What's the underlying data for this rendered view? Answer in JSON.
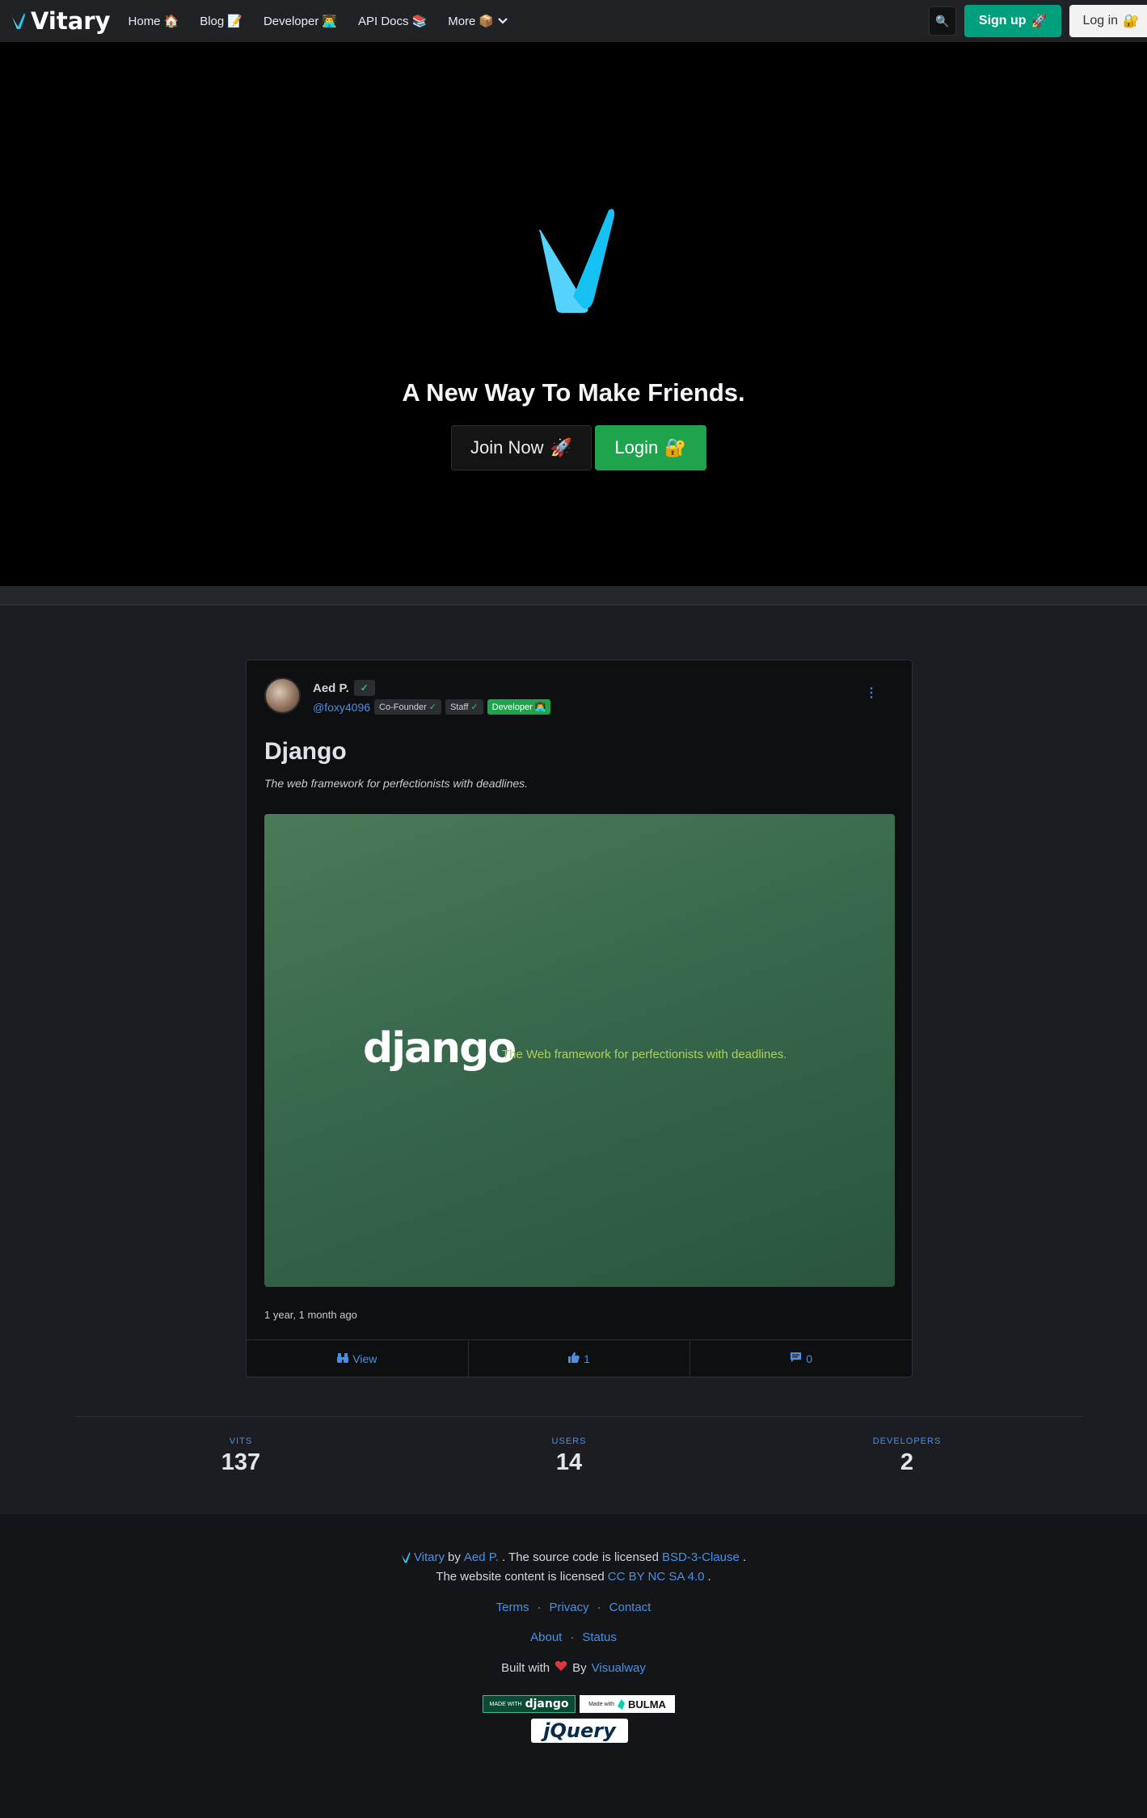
{
  "navbar": {
    "brand": "Vitary",
    "items": [
      {
        "label": "Home",
        "emoji": "🏠"
      },
      {
        "label": "Blog",
        "emoji": "📝"
      },
      {
        "label": "Developer",
        "emoji": "👨‍💻"
      },
      {
        "label": "API Docs",
        "emoji": "📚"
      },
      {
        "label": "More",
        "emoji": "📦"
      }
    ],
    "search_emoji": "🔍",
    "signup_label": "Sign up",
    "signup_emoji": "🚀",
    "login_label": "Log in",
    "login_emoji": "🔐"
  },
  "hero": {
    "title": "A New Way To Make Friends.",
    "join_label": "Join Now",
    "join_emoji": "🚀",
    "login_label": "Login",
    "login_emoji": "🔐"
  },
  "post": {
    "author_name": "Aed P.",
    "handle": "@foxy4096",
    "tags": [
      {
        "label": "Co-Founder"
      },
      {
        "label": "Staff"
      },
      {
        "label": "Developer",
        "emoji": "👨‍💻"
      }
    ],
    "title": "Django",
    "subtitle": "The web framework for perfectionists with deadlines.",
    "image_word": "django",
    "image_tagline": "The Web framework for perfectionists with deadlines.",
    "time": "1 year, 1 month ago",
    "actions": {
      "view_label": "View",
      "likes": "1",
      "comments": "0"
    }
  },
  "stats": [
    {
      "label": "VITS",
      "value": "137"
    },
    {
      "label": "USERS",
      "value": "14"
    },
    {
      "label": "DEVELOPERS",
      "value": "2"
    }
  ],
  "footer": {
    "brand": "Vitary",
    "by": "by",
    "author": "Aed P.",
    "license_text": ". The source code is licensed",
    "license_link": "BSD-3-Clause",
    "content_text": "The website content is licensed",
    "content_link": "CC BY NC SA 4.0",
    "links1": [
      "Terms",
      "Privacy",
      "Contact"
    ],
    "links2": [
      "About",
      "Status"
    ],
    "built_text": "Built with",
    "built_by": "By",
    "built_by_link": "Visualway",
    "badge_django_small": "MADE WITH",
    "badge_django_big": "django",
    "badge_bulma_small": "Made with",
    "badge_bulma_big": "BULMA",
    "badge_jquery": "jQuery"
  },
  "colors": {
    "accent_blue": "#4a90e2",
    "green": "#1fa44d",
    "teal": "#00a07f",
    "logo_cyan": "#1fc8f5"
  }
}
